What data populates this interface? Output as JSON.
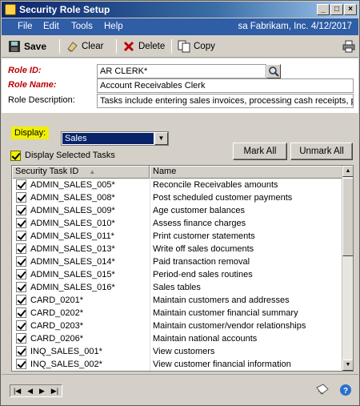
{
  "window": {
    "title": "Security Role Setup"
  },
  "menu": {
    "items": [
      "File",
      "Edit",
      "Tools",
      "Help"
    ],
    "status": "sa  Fabrikam, Inc.  4/12/2017"
  },
  "toolbar": {
    "save": "Save",
    "clear": "Clear",
    "delete": "Delete",
    "copy": "Copy"
  },
  "form": {
    "role_id_label": "Role ID:",
    "role_id": "AR CLERK*",
    "role_name_label": "Role Name:",
    "role_name": "Account Receivables Clerk",
    "role_desc_label": "Role Description:",
    "role_desc": "Tasks include entering sales invoices, processing cash receipts, prepa"
  },
  "display": {
    "label": "Display:",
    "selected": "Sales",
    "display_selected_label": "Display Selected Tasks",
    "display_selected_checked": true,
    "mark_all": "Mark All",
    "unmark_all": "Unmark All"
  },
  "grid": {
    "columns": [
      "Security Task ID",
      "Name"
    ],
    "rows": [
      {
        "id": "ADMIN_SALES_005*",
        "name": "Reconcile Receivables amounts",
        "checked": true
      },
      {
        "id": "ADMIN_SALES_008*",
        "name": "Post scheduled customer payments",
        "checked": true
      },
      {
        "id": "ADMIN_SALES_009*",
        "name": "Age customer balances",
        "checked": true
      },
      {
        "id": "ADMIN_SALES_010*",
        "name": "Assess finance charges",
        "checked": true
      },
      {
        "id": "ADMIN_SALES_011*",
        "name": "Print customer statements",
        "checked": true
      },
      {
        "id": "ADMIN_SALES_013*",
        "name": "Write off sales documents",
        "checked": true
      },
      {
        "id": "ADMIN_SALES_014*",
        "name": "Paid transaction removal",
        "checked": true
      },
      {
        "id": "ADMIN_SALES_015*",
        "name": "Period-end sales routines",
        "checked": true
      },
      {
        "id": "ADMIN_SALES_016*",
        "name": "Sales tables",
        "checked": true
      },
      {
        "id": "CARD_0201*",
        "name": "Maintain customers and addresses",
        "checked": true
      },
      {
        "id": "CARD_0202*",
        "name": "Maintain customer financial summary",
        "checked": true
      },
      {
        "id": "CARD_0203*",
        "name": "Maintain customer/vendor relationships",
        "checked": true
      },
      {
        "id": "CARD_0206*",
        "name": "Maintain national accounts",
        "checked": true
      },
      {
        "id": "INQ_SALES_001*",
        "name": "View customers",
        "checked": true
      },
      {
        "id": "INQ_SALES_002*",
        "name": "View customer financial information",
        "checked": true
      }
    ]
  },
  "colors": {
    "titlebar": "#0a246a",
    "menubar": "#2f5da6",
    "highlight": "#f0f000",
    "required": "#c00000"
  }
}
